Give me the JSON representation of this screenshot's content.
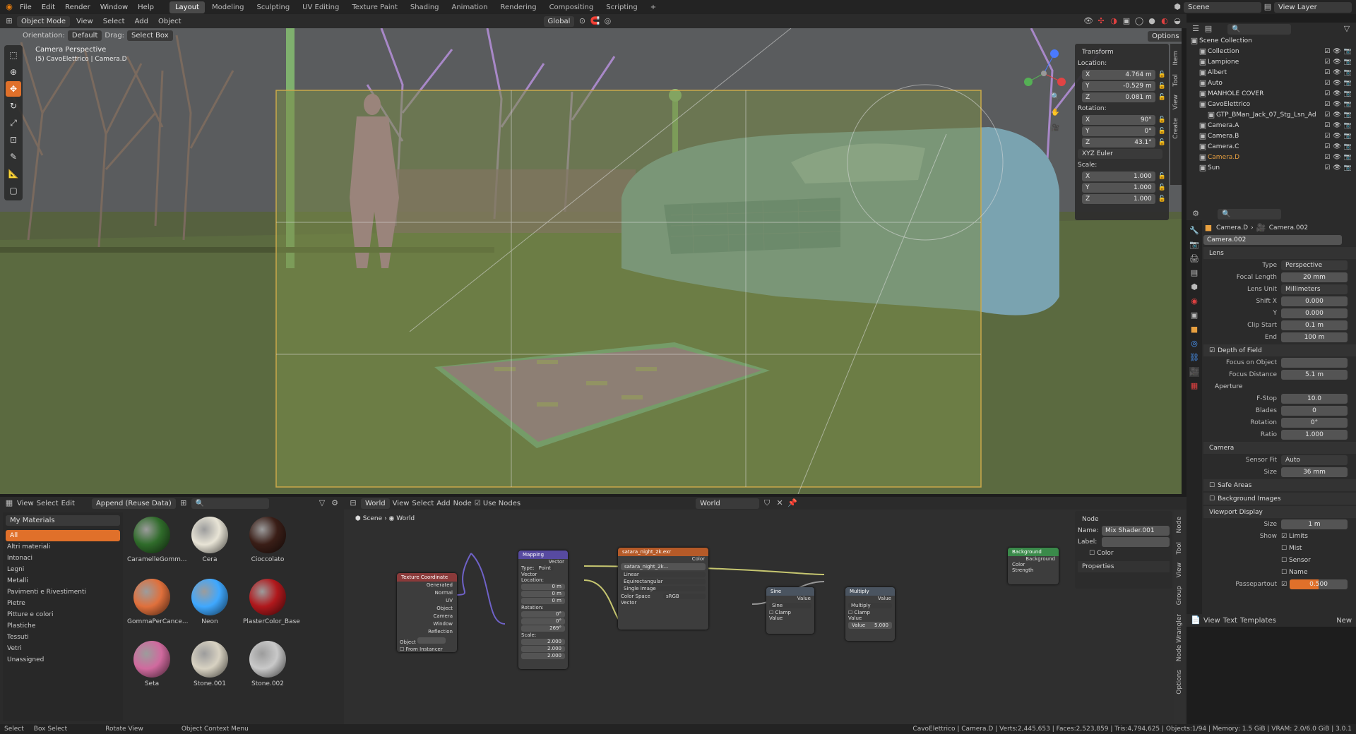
{
  "topbar": {
    "menus": [
      "File",
      "Edit",
      "Render",
      "Window",
      "Help"
    ],
    "workspaces": [
      "Layout",
      "Modeling",
      "Sculpting",
      "UV Editing",
      "Texture Paint",
      "Shading",
      "Animation",
      "Rendering",
      "Compositing",
      "Scripting"
    ],
    "active_workspace": "Layout",
    "add_tab": "+",
    "scene_name": "Scene",
    "view_layer": "View Layer"
  },
  "vp_header": {
    "mode": "Object Mode",
    "menus": [
      "View",
      "Select",
      "Add",
      "Object"
    ],
    "orientation": "Global",
    "options": "Options",
    "orientation_label": "Orientation:",
    "orientation_value": "Default",
    "drag_label": "Drag:",
    "drag_value": "Select Box"
  },
  "viewport": {
    "camera_label": "Camera Perspective",
    "object_label": "(5) CavoElettrico | Camera.D"
  },
  "npanel": {
    "tabs": [
      "Item",
      "Tool",
      "View",
      "Create"
    ],
    "section": "Transform",
    "location_label": "Location:",
    "location": [
      {
        "axis": "X",
        "value": "4.764 m"
      },
      {
        "axis": "Y",
        "value": "-0.529 m"
      },
      {
        "axis": "Z",
        "value": "0.081 m"
      }
    ],
    "rotation_label": "Rotation:",
    "rotation": [
      {
        "axis": "X",
        "value": "90°"
      },
      {
        "axis": "Y",
        "value": "0°"
      },
      {
        "axis": "Z",
        "value": "43.1°"
      }
    ],
    "rotation_mode": "XYZ Euler",
    "scale_label": "Scale:",
    "scale": [
      {
        "axis": "X",
        "value": "1.000"
      },
      {
        "axis": "Y",
        "value": "1.000"
      },
      {
        "axis": "Z",
        "value": "1.000"
      }
    ]
  },
  "outliner": {
    "root": "Scene Collection",
    "items": [
      {
        "name": "Collection",
        "indent": 1
      },
      {
        "name": "Lampione",
        "indent": 1
      },
      {
        "name": "Albert",
        "indent": 1
      },
      {
        "name": "Auto",
        "indent": 1
      },
      {
        "name": "MANHOLE COVER",
        "indent": 1
      },
      {
        "name": "CavoElettrico",
        "indent": 1
      },
      {
        "name": "GTP_BMan_Jack_07_Stg_Lsn_Ad",
        "indent": 2
      },
      {
        "name": "Camera.A",
        "indent": 1
      },
      {
        "name": "Camera.B",
        "indent": 1
      },
      {
        "name": "Camera.C",
        "indent": 1
      },
      {
        "name": "Camera.D",
        "indent": 1
      },
      {
        "name": "Sun",
        "indent": 1
      }
    ]
  },
  "properties": {
    "breadcrumb_obj": "Camera.D",
    "breadcrumb_data": "Camera.002",
    "data_name": "Camera.002",
    "lens": {
      "title": "Lens",
      "type_label": "Type",
      "type": "Perspective",
      "focal_label": "Focal Length",
      "focal": "20 mm",
      "unit_label": "Lens Unit",
      "unit": "Millimeters",
      "shiftx_label": "Shift X",
      "shiftx": "0.000",
      "shifty_label": "Y",
      "shifty": "0.000",
      "clipstart_label": "Clip Start",
      "clipstart": "0.1 m",
      "clipend_label": "End",
      "clipend": "100 m"
    },
    "dof": {
      "title": "Depth of Field",
      "focus_obj_label": "Focus on Object",
      "focus_dist_label": "Focus Distance",
      "focus_dist": "5.1 m",
      "aperture": "Aperture",
      "fstop_label": "F-Stop",
      "fstop": "10.0",
      "blades_label": "Blades",
      "blades": "0",
      "rotation_label": "Rotation",
      "rotation": "0°",
      "ratio_label": "Ratio",
      "ratio": "1.000"
    },
    "camera": {
      "title": "Camera",
      "sensor_fit_label": "Sensor Fit",
      "sensor_fit": "Auto",
      "size_label": "Size",
      "size": "36 mm"
    },
    "safe_areas": "Safe Areas",
    "bg_images": "Background Images",
    "viewport_display": {
      "title": "Viewport Display",
      "size_label": "Size",
      "size": "1 m",
      "show_label": "Show",
      "show_items": [
        "Limits",
        "Mist",
        "Sensor",
        "Name"
      ],
      "passepartout_label": "Passepartout",
      "passepartout": "0.500",
      "passepartout_fraction": 0.5
    },
    "text_menus": [
      "View",
      "Text",
      "Templates"
    ],
    "new_label": "New"
  },
  "asset_browser": {
    "header": [
      "View",
      "Select",
      "Edit"
    ],
    "import_mode": "Append (Reuse Data)",
    "library": "My Materials",
    "categories": [
      "All",
      "Altri materiali",
      "Intonaci",
      "Legni",
      "Metalli",
      "Pavimenti e Rivestimenti",
      "Pietre",
      "Pitture e colori",
      "Plastiche",
      "Tessuti",
      "Vetri",
      "Unassigned"
    ],
    "materials": [
      {
        "name": "CaramelleGomm...",
        "color": "#2f6b2a"
      },
      {
        "name": "Cera",
        "color": "#e8e4d6"
      },
      {
        "name": "Cioccolato",
        "color": "#3a1e17"
      },
      {
        "name": "GommaPerCance...",
        "color": "#e0703c"
      },
      {
        "name": "Neon",
        "color": "#3fa8ff"
      },
      {
        "name": "PlasterColor_Base",
        "color": "#b0181c"
      },
      {
        "name": "Seta",
        "color": "#d06a9e"
      },
      {
        "name": "Stone.001",
        "color": "#d8d2c2"
      },
      {
        "name": "Stone.002",
        "color": "#c9c9c9"
      }
    ]
  },
  "node_editor": {
    "header": {
      "type": "World",
      "menus": [
        "View",
        "Select",
        "Add",
        "Node"
      ],
      "use_nodes": "Use Nodes",
      "world": "World"
    },
    "breadcrumb": [
      "Scene",
      "World"
    ],
    "nodes": {
      "texcoord": {
        "title": "Texture Coordinate",
        "outputs": [
          "Generated",
          "Normal",
          "UV",
          "Object",
          "Camera",
          "Window",
          "Reflection"
        ],
        "object_label": "Object",
        "instancer": "From Instancer"
      },
      "mapping": {
        "title": "Mapping",
        "out": "Vector",
        "type_label": "Type:",
        "type": "Point",
        "in": "Vector",
        "location_label": "Location:",
        "location": [
          "0 m",
          "0 m",
          "0 m"
        ],
        "rotation_label": "Rotation:",
        "rotation": [
          "0°",
          "0°",
          "269°"
        ],
        "scale_label": "Scale:",
        "scale": [
          "2.000",
          "2.000",
          "2.000"
        ]
      },
      "envtex": {
        "title": "satara_night_2k.exr",
        "out": "Color",
        "image": "satara_night_2k...",
        "interp": "Linear",
        "proj": "Equirectangular",
        "src": "Single Image",
        "cs_label": "Color Space",
        "cs": "sRGB",
        "in": "Vector"
      },
      "sine": {
        "title": "Sine",
        "out": "Value",
        "op": "Sine",
        "clamp": "Clamp",
        "in": "Value"
      },
      "multiply": {
        "title": "Multiply",
        "out": "Value",
        "op": "Multiply",
        "clamp": "Clamp",
        "in": "Value",
        "value_label": "Value",
        "value": "5.000"
      },
      "background": {
        "title": "Background",
        "out": "Background",
        "in1": "Color",
        "in2": "Strength"
      }
    },
    "side": {
      "tabs": [
        "Node",
        "Tool",
        "View",
        "Group",
        "Node Wrangler",
        "Options"
      ],
      "section": "Node",
      "name_label": "Name:",
      "name": "Mix Shader.001",
      "label_label": "Label:",
      "color": "Color",
      "properties": "Properties"
    }
  },
  "status": {
    "items": [
      "Select",
      "Box Select",
      "Rotate View",
      "Object Context Menu"
    ],
    "stats": "CavoElettrico | Camera.D | Verts:2,445,653 | Faces:2,523,859 | Tris:4,794,625 | Objects:1/94 | Memory: 1.5 GiB | VRAM: 2.0/6.0 GiB | 3.0.1"
  }
}
